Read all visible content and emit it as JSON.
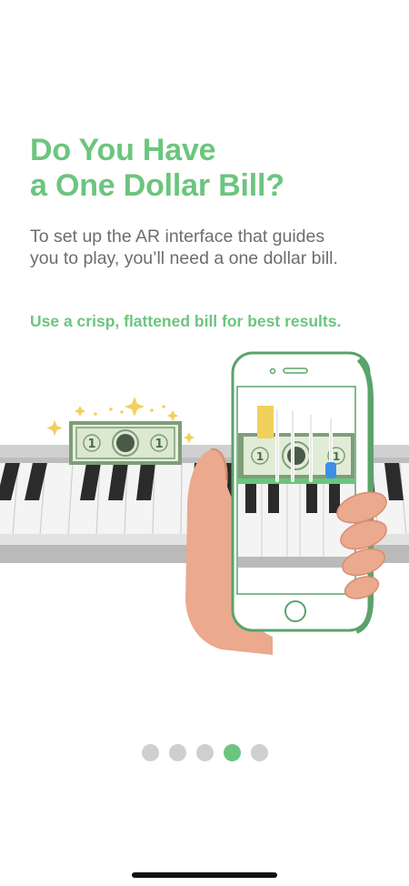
{
  "onboarding": {
    "title_lines": [
      "Do You Have",
      "a One Dollar Bill?"
    ],
    "description_lines": [
      "To set up the AR interface that guides",
      "you to play, you’ll need a one dollar bill."
    ],
    "tip": "Use a crisp, flattened bill for best results.",
    "bill_denomination": "1",
    "pagination": {
      "total": 5,
      "active_index": 3
    }
  },
  "colors": {
    "accent": "#6cc57e",
    "body_text": "#6d6d6d",
    "dot_inactive": "#cfcfcf"
  }
}
